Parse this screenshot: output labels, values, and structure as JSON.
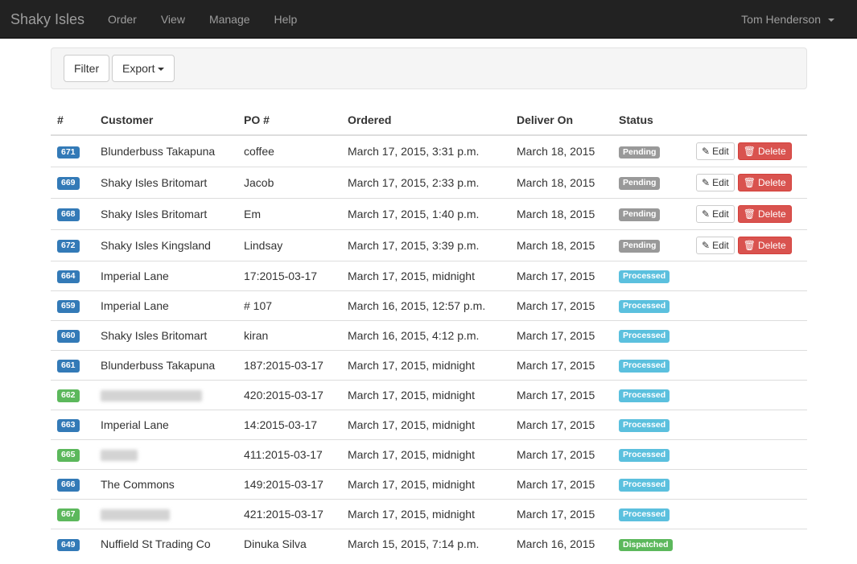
{
  "navbar": {
    "brand": "Shaky Isles",
    "links": [
      "Order",
      "View",
      "Manage",
      "Help"
    ],
    "user": "Tom Henderson"
  },
  "toolbar": {
    "filter_label": "Filter",
    "export_label": "Export"
  },
  "table": {
    "headers": [
      "#",
      "Customer",
      "PO #",
      "Ordered",
      "Deliver On",
      "Status"
    ],
    "edit_label": "Edit",
    "delete_label": "Delete",
    "rows": [
      {
        "id": "671",
        "id_color": "primary",
        "customer": "Blunderbuss Takapuna",
        "po": "coffee",
        "ordered": "March 17, 2015, 3:31 p.m.",
        "deliver": "March 18, 2015",
        "status": "Pending"
      },
      {
        "id": "669",
        "id_color": "primary",
        "customer": "Shaky Isles Britomart",
        "po": "Jacob",
        "ordered": "March 17, 2015, 2:33 p.m.",
        "deliver": "March 18, 2015",
        "status": "Pending"
      },
      {
        "id": "668",
        "id_color": "primary",
        "customer": "Shaky Isles Britomart",
        "po": "Em",
        "ordered": "March 17, 2015, 1:40 p.m.",
        "deliver": "March 18, 2015",
        "status": "Pending"
      },
      {
        "id": "672",
        "id_color": "primary",
        "customer": "Shaky Isles Kingsland",
        "po": "Lindsay",
        "ordered": "March 17, 2015, 3:39 p.m.",
        "deliver": "March 18, 2015",
        "status": "Pending"
      },
      {
        "id": "664",
        "id_color": "primary",
        "customer": "Imperial Lane",
        "po": "17:2015-03-17",
        "ordered": "March 17, 2015, midnight",
        "deliver": "March 17, 2015",
        "status": "Processed"
      },
      {
        "id": "659",
        "id_color": "primary",
        "customer": "Imperial Lane",
        "po": "# 107",
        "ordered": "March 16, 2015, 12:57 p.m.",
        "deliver": "March 17, 2015",
        "status": "Processed"
      },
      {
        "id": "660",
        "id_color": "primary",
        "customer": "Shaky Isles Britomart",
        "po": "kiran",
        "ordered": "March 16, 2015, 4:12 p.m.",
        "deliver": "March 17, 2015",
        "status": "Processed"
      },
      {
        "id": "661",
        "id_color": "primary",
        "customer": "Blunderbuss Takapuna",
        "po": "187:2015-03-17",
        "ordered": "March 17, 2015, midnight",
        "deliver": "March 17, 2015",
        "status": "Processed"
      },
      {
        "id": "662",
        "id_color": "success",
        "customer": "",
        "po": "420:2015-03-17",
        "ordered": "March 17, 2015, midnight",
        "deliver": "March 17, 2015",
        "status": "Processed"
      },
      {
        "id": "663",
        "id_color": "primary",
        "customer": "Imperial Lane",
        "po": "14:2015-03-17",
        "ordered": "March 17, 2015, midnight",
        "deliver": "March 17, 2015",
        "status": "Processed"
      },
      {
        "id": "665",
        "id_color": "success",
        "customer": "",
        "po": "411:2015-03-17",
        "ordered": "March 17, 2015, midnight",
        "deliver": "March 17, 2015",
        "status": "Processed"
      },
      {
        "id": "666",
        "id_color": "primary",
        "customer": "The Commons",
        "po": "149:2015-03-17",
        "ordered": "March 17, 2015, midnight",
        "deliver": "March 17, 2015",
        "status": "Processed"
      },
      {
        "id": "667",
        "id_color": "success",
        "customer": "",
        "po": "421:2015-03-17",
        "ordered": "March 17, 2015, midnight",
        "deliver": "March 17, 2015",
        "status": "Processed"
      },
      {
        "id": "649",
        "id_color": "primary",
        "customer": "Nuffield St Trading Co",
        "po": "Dinuka Silva",
        "ordered": "March 15, 2015, 7:14 p.m.",
        "deliver": "March 16, 2015",
        "status": "Dispatched"
      }
    ]
  }
}
